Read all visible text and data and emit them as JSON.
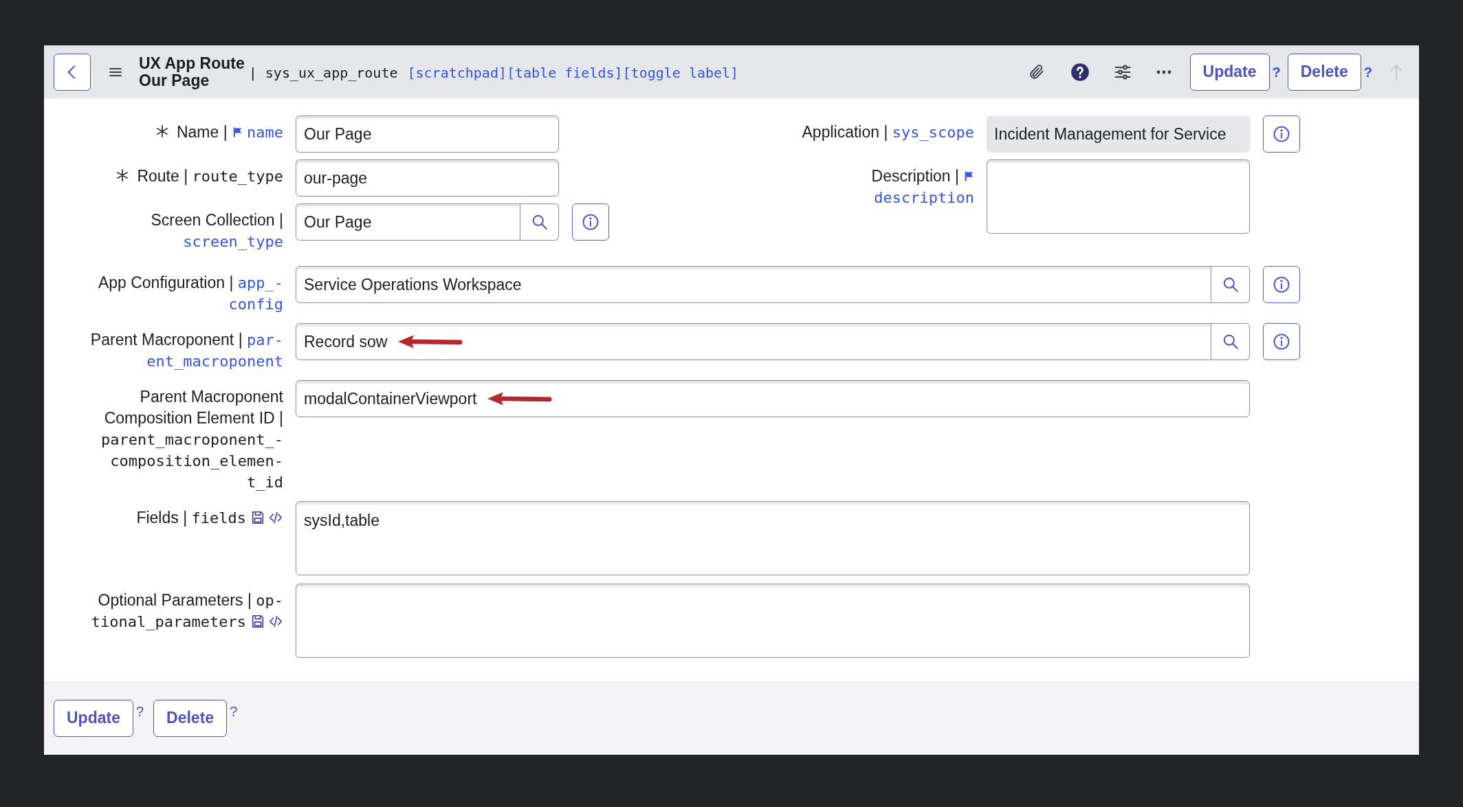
{
  "header": {
    "title_lines": [
      "UX App Route",
      "Our Page"
    ],
    "table_name": "| sys_ux_app_route",
    "links": [
      "[scratchpad]",
      "[table fields]",
      "[toggle label]"
    ],
    "buttons": [
      {
        "label": "Update",
        "help": "?"
      },
      {
        "label": "Delete",
        "help": "?"
      }
    ]
  },
  "form": {
    "top_left": [
      {
        "required": true,
        "label_lines": [
          "Name |"
        ],
        "flag": true,
        "name_lines": [
          "name"
        ],
        "name_link": true,
        "kind": "text",
        "value": "Our Page"
      },
      {
        "required": true,
        "label_lines": [
          "Route |"
        ],
        "name_lines": [
          "route_type"
        ],
        "name_link": false,
        "kind": "text",
        "value": "our-page"
      },
      {
        "label_lines": [
          "Screen Collection |"
        ],
        "name_lines": [
          "screen_type"
        ],
        "name_link": true,
        "kind": "reference",
        "value": "Our Page",
        "info": true
      }
    ],
    "top_right": [
      {
        "label_lines": [
          "Application |"
        ],
        "name_lines": [
          "sys_scope"
        ],
        "name_link": true,
        "kind": "readonly",
        "value": "Incident Management for Service",
        "info": true
      },
      {
        "label_lines": [
          "Description |"
        ],
        "flag": true,
        "name_lines": [
          "description"
        ],
        "name_link": true,
        "kind": "textarea"
      }
    ],
    "rows": [
      {
        "label_lines": [
          "App Configuration |"
        ],
        "name_lines": [
          "app_-",
          "config"
        ],
        "name_link": true,
        "kind": "reference",
        "value": "Service Operations Workspace",
        "info": true
      },
      {
        "label_lines": [
          "Parent Macroponent |"
        ],
        "name_lines": [
          "par-",
          "ent_macroponent"
        ],
        "name_link": true,
        "kind": "reference",
        "value": "Record sow",
        "info": true,
        "arrow": true
      },
      {
        "label_lines": [
          "Parent Macroponent",
          "Composition Element ID |"
        ],
        "name_lines": [
          "parent_macroponent_-",
          "composition_elemen-",
          "t_id"
        ],
        "name_link": false,
        "kind": "text",
        "value": "modalContainerViewport",
        "arrow": true
      },
      {
        "label_lines": [
          "Fields |"
        ],
        "name_lines": [
          "fields"
        ],
        "name_link": false,
        "kind": "script",
        "value": "sysId,table"
      },
      {
        "label_lines": [
          "Optional Parameters |"
        ],
        "name_lines": [
          "op-",
          "tional_parameters"
        ],
        "name_link": false,
        "kind": "script"
      }
    ]
  },
  "footer": {
    "buttons": [
      {
        "label": "Update",
        "help": "?"
      },
      {
        "label": "Delete",
        "help": "?"
      }
    ]
  }
}
